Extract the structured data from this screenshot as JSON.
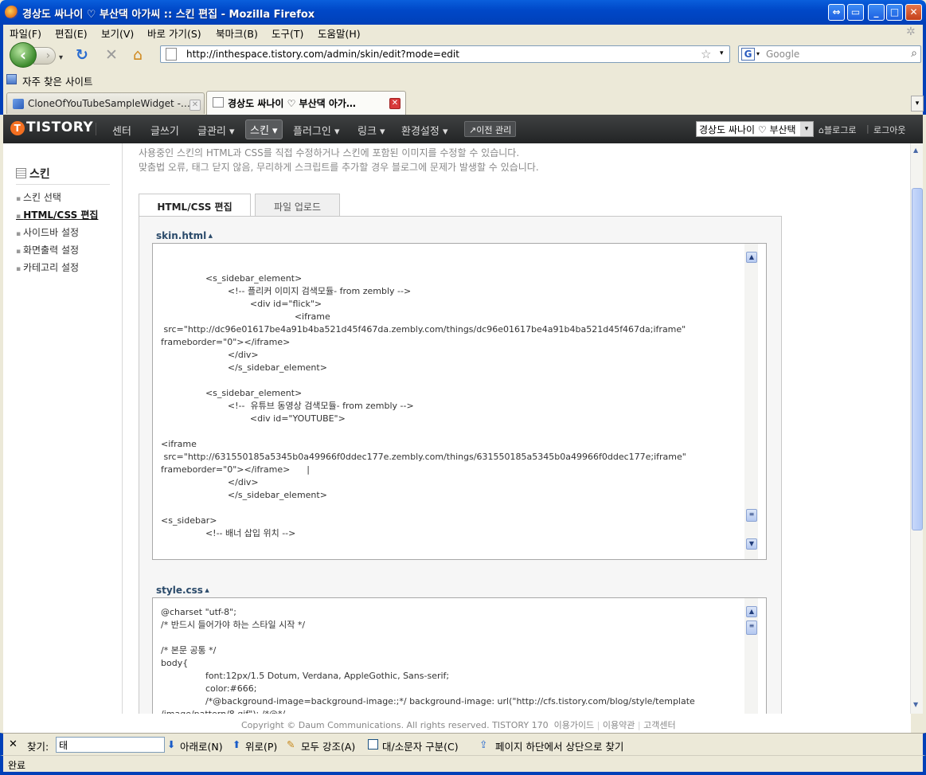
{
  "window": {
    "title": "경상도 싸나이 ♡ 부산댁 아가씨 :: 스킨 편집 - Mozilla Firefox"
  },
  "menu": [
    "파일(F)",
    "편집(E)",
    "보기(V)",
    "바로 가기(S)",
    "북마크(B)",
    "도구(T)",
    "도움말(H)"
  ],
  "nav": {
    "url": "http://inthespace.tistory.com/admin/skin/edit?mode=edit",
    "search_placeholder": "Google",
    "search_engine": "G"
  },
  "bookmarks": {
    "item": "자주 찾은 사이트"
  },
  "tabs": [
    {
      "label": "CloneOfYouTubeSampleWidget -…",
      "active": false
    },
    {
      "label": "경상도 싸나이 ♡ 부산댁 아가…",
      "active": true
    }
  ],
  "tistory": {
    "logo": "TISTORY",
    "menu": [
      "센터",
      "글쓰기",
      "글관리 ▾",
      "스킨 ▾",
      "플러그인 ▾",
      "링크 ▾",
      "환경설정 ▾"
    ],
    "old_admin": "↗이전 관리",
    "blog_select": "경상도 싸나이 ♡ 부산택",
    "blog_link": "⌂블로그로",
    "logout": "로그아웃"
  },
  "sidebar": {
    "heading": "스킨",
    "items": [
      "스킨 선택",
      "HTML/CSS 편집",
      "사이드바 설정",
      "화면출력 설정",
      "카테고리 설정"
    ]
  },
  "description": [
    "사용중인 스킨의 HTML과 CSS를 직접 수정하거나 스킨에 포함된 이미지를 수정할 수 있습니다.",
    "맞춤법 오류, 태그 닫지 않음, 무리하게 스크립트를 추가할 경우 블로그에 문제가 발생할 수 있습니다."
  ],
  "subtabs": [
    "HTML/CSS 편집",
    "파일 업로드"
  ],
  "skin_html": {
    "label": "skin.html",
    "code": "\n                <s_sidebar_element>\n                        <!-- 플리커 이미지 검색모듈- from zembly -->\n                                <div id=\"flick\">\n                                                <iframe\n src=\"http://dc96e01617be4a91b4ba521d45f467da.zembly.com/things/dc96e01617be4a91b4ba521d45f467da;iframe\"\nframeborder=\"0\"></iframe>\n                        </div>\n                        </s_sidebar_element>\n\n                <s_sidebar_element>\n                        <!--  유튜브 동영상 검색모듈- from zembly -->\n                                <div id=\"YOUTUBE\">\n\n<iframe\n src=\"http://631550185a5345b0a49966f0ddec177e.zembly.com/things/631550185a5345b0a49966f0ddec177e;iframe\"\nframeborder=\"0\"></iframe>      |\n                        </div>\n                        </s_sidebar_element>\n\n<s_sidebar>\n                <!-- 배너 삽입 위치 -->"
  },
  "style_css": {
    "label": "style.css",
    "code": "@charset \"utf-8\";\n/* 반드시 들어가야 하는 스타일 시작 */\n\n/* 본문 공통 */\nbody{\n                font:12px/1.5 Dotum, Verdana, AppleGothic, Sans-serif;\n                color:#666;\n                /*@background-image=background-image:;*/ background-image: url(\"http://cfs.tistory.com/blog/style/template\n/image/pattern/8.gif\"); /*@*/"
  },
  "footer": {
    "copyright": "Copyright © Daum Communications. All rights reserved. TISTORY 170",
    "links": [
      "이용가이드",
      "이용약관",
      "고객센터"
    ]
  },
  "findbar": {
    "label": "찾기:",
    "value": "태",
    "next": "아래로(N)",
    "prev": "위로(P)",
    "highlight": "모두 강조(A)",
    "matchcase": "대/소문자 구분(C)",
    "status": "페이지 하단에서 상단으로 찾기"
  },
  "status": {
    "text": "완료"
  },
  "colors": {
    "xp_titlebar": "#0048c8",
    "tistory_nav": "#2e3031",
    "tistory_orange": "#f37021"
  }
}
